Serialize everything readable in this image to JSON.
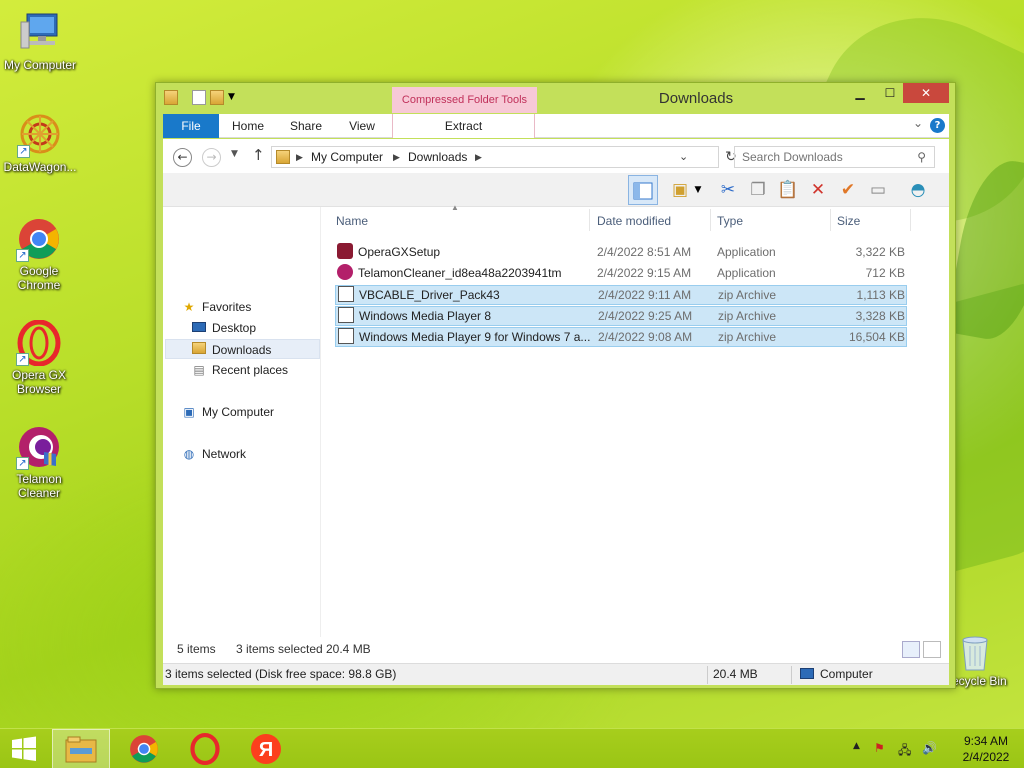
{
  "desktop": {
    "icons": [
      {
        "label": "My Computer"
      },
      {
        "label": "DataWagon..."
      },
      {
        "label": "Google Chrome"
      },
      {
        "label": "Opera GX Browser"
      },
      {
        "label": "Telamon Cleaner"
      },
      {
        "label": "Recycle Bin"
      }
    ]
  },
  "window": {
    "title": "Downloads",
    "context_tab": "Compressed Folder Tools",
    "ribbon_tabs": [
      "File",
      "Home",
      "Share",
      "View",
      "Extract"
    ],
    "help": "?",
    "address": {
      "crumbs": [
        "My Computer",
        "Downloads"
      ]
    },
    "search": {
      "placeholder": "Search Downloads"
    },
    "nav_pane": {
      "favorites": "Favorites",
      "desktop": "Desktop",
      "downloads": "Downloads",
      "recent": "Recent places",
      "my_computer": "My Computer",
      "network": "Network"
    },
    "columns": {
      "name": "Name",
      "date": "Date modified",
      "type": "Type",
      "size": "Size"
    },
    "files": [
      {
        "name": "OperaGXSetup",
        "date": "2/4/2022 8:51 AM",
        "type": "Application",
        "size": "3,322 KB",
        "selected": false
      },
      {
        "name": "TelamonCleaner_id8ea48a2203941tm",
        "date": "2/4/2022 9:15 AM",
        "type": "Application",
        "size": "712 KB",
        "selected": false
      },
      {
        "name": "VBCABLE_Driver_Pack43",
        "date": "2/4/2022 9:11 AM",
        "type": "zip Archive",
        "size": "1,113 KB",
        "selected": true
      },
      {
        "name": "Windows Media Player 8",
        "date": "2/4/2022 9:25 AM",
        "type": "zip Archive",
        "size": "3,328 KB",
        "selected": true
      },
      {
        "name": "Windows Media Player 9 for Windows 7 a...",
        "date": "2/4/2022 9:08 AM",
        "type": "zip Archive",
        "size": "16,504 KB",
        "selected": true
      }
    ],
    "status": {
      "items": "5 items",
      "selected": "3 items selected",
      "selected_size": "20.4 MB",
      "bar_text": "3 items selected (Disk free space: 98.8 GB)",
      "bar_size": "20.4 MB",
      "bar_location": "Computer"
    }
  },
  "taskbar": {
    "time": "9:34 AM",
    "date": "2/4/2022"
  },
  "colors": {
    "accent": "#1979ca",
    "selection": "#cce6f7",
    "close": "#c9483d",
    "context_tab": "#f7c9d6"
  }
}
